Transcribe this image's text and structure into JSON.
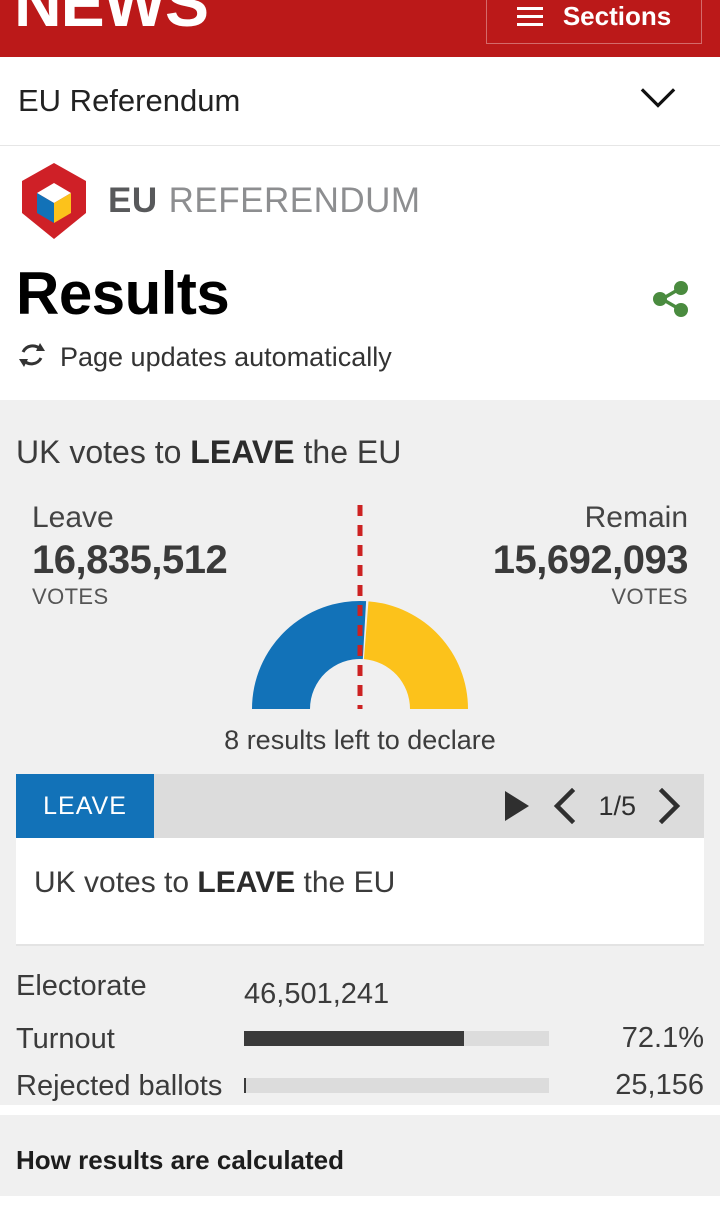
{
  "masthead": {
    "wordmark": "NEWS",
    "sections_label": "Sections"
  },
  "subnav": {
    "title": "EU Referendum"
  },
  "branding": {
    "logo_eu": "EU",
    "logo_referendum": "REFERENDUM"
  },
  "header": {
    "page_title": "Results",
    "updates_text": "Page updates automatically"
  },
  "summary": {
    "headline_prefix": "UK votes to ",
    "headline_emphasis": "LEAVE",
    "headline_suffix": " the EU",
    "declare_text": "8 results left to declare",
    "leave": {
      "name": "Leave",
      "votes": "16,835,512",
      "unit": "VOTES"
    },
    "remain": {
      "name": "Remain",
      "votes": "15,692,093",
      "unit": "VOTES"
    }
  },
  "carousel": {
    "badge_label": "LEAVE",
    "page_indicator": "1/5",
    "panel_prefix": "UK votes to ",
    "panel_emphasis": "LEAVE",
    "panel_suffix": " the EU"
  },
  "stats": {
    "electorate": {
      "label": "Electorate",
      "value": "46,501,241"
    },
    "turnout": {
      "label": "Turnout",
      "value": "72.1%"
    },
    "rejected": {
      "label": "Rejected ballots",
      "value": "25,156"
    }
  },
  "footer": {
    "how_calculated": "How results are calculated"
  },
  "colors": {
    "bbc_red": "#bb1919",
    "leave_blue": "#1272b8",
    "remain_yellow": "#fcc21b",
    "midline_red": "#cc2222",
    "share_green": "#4a8b3f",
    "panel_grey": "#f0f0f0",
    "bar_track": "#dcdcdc",
    "bar_fill": "#3a3a3a"
  },
  "chart_data": {
    "type": "pie",
    "title": "EU Referendum result gauge",
    "shape": "semicircular-donut",
    "categories": [
      "Leave",
      "Remain"
    ],
    "values": [
      16835512,
      15692093
    ],
    "percentages": [
      51.8,
      48.2
    ],
    "colors": [
      "#1272b8",
      "#fcc21b"
    ],
    "annotations": [
      "50% threshold marked by red dashed line"
    ],
    "legend": "side labels",
    "secondary_bars": {
      "type": "bar",
      "categories": [
        "Turnout",
        "Rejected ballots"
      ],
      "values": [
        72.1,
        0.8
      ],
      "value_labels": [
        "72.1%",
        "25,156"
      ],
      "xlim": [
        0,
        100
      ]
    }
  }
}
